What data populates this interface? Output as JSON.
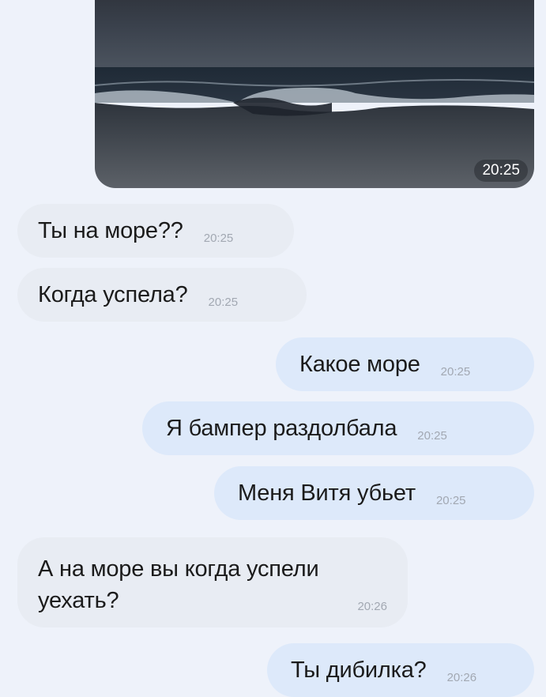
{
  "messages": [
    {
      "direction": "out",
      "type": "photo",
      "time": "20:25"
    },
    {
      "direction": "in",
      "text": "Ты на море??",
      "time": "20:25"
    },
    {
      "direction": "in",
      "text": "Когда успела?",
      "time": "20:25"
    },
    {
      "direction": "out",
      "text": "Какое море",
      "time": "20:25"
    },
    {
      "direction": "out",
      "text": "Я бампер раздолбала",
      "time": "20:25"
    },
    {
      "direction": "out",
      "text": "Меня Витя убьет",
      "time": "20:25"
    },
    {
      "direction": "in",
      "text_lines": [
        "А на море вы когда успели",
        "уехать?"
      ],
      "time": "20:26"
    },
    {
      "direction": "out",
      "text": "Ты дибилка?",
      "time": "20:26"
    }
  ],
  "colors": {
    "background": "#eef2fa",
    "incoming_bubble": "#e8ecf3",
    "outgoing_bubble": "#dde9fa",
    "text": "#1b1b1b",
    "timestamp": "#a2a8b2"
  }
}
